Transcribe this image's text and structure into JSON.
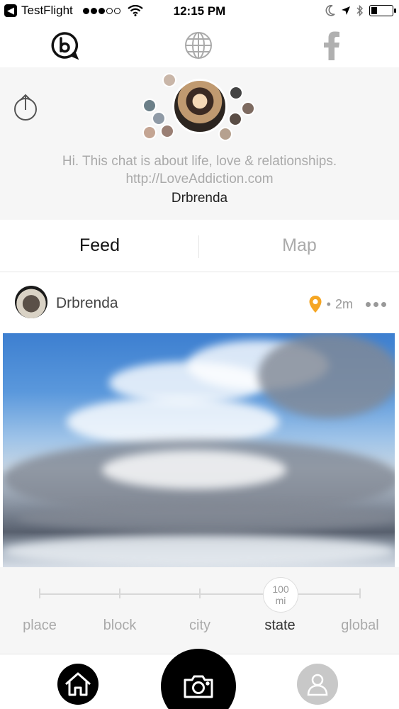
{
  "status_bar": {
    "back_app": "TestFlight",
    "time": "12:15 PM"
  },
  "top_nav": {
    "icons": [
      "chat-bubble-b-icon",
      "globe-icon",
      "facebook-icon"
    ]
  },
  "header": {
    "bio_line1": "Hi. This chat is about life, love & relationships.",
    "bio_line2": "http://LoveAddiction.com",
    "owner": "Drbrenda"
  },
  "tabs": [
    {
      "label": "Feed",
      "active": true
    },
    {
      "label": "Map",
      "active": false
    }
  ],
  "post": {
    "author": "Drbrenda",
    "time_ago": "2m",
    "separator": "•"
  },
  "distance": {
    "scale": [
      "place",
      "block",
      "city",
      "state",
      "global"
    ],
    "selected": "state",
    "knob_value": "100",
    "knob_unit": "mi"
  },
  "colors": {
    "accent_pin": "#f5a623",
    "header_bg": "#f6f6f6",
    "inactive_text": "#aaaaaa"
  }
}
